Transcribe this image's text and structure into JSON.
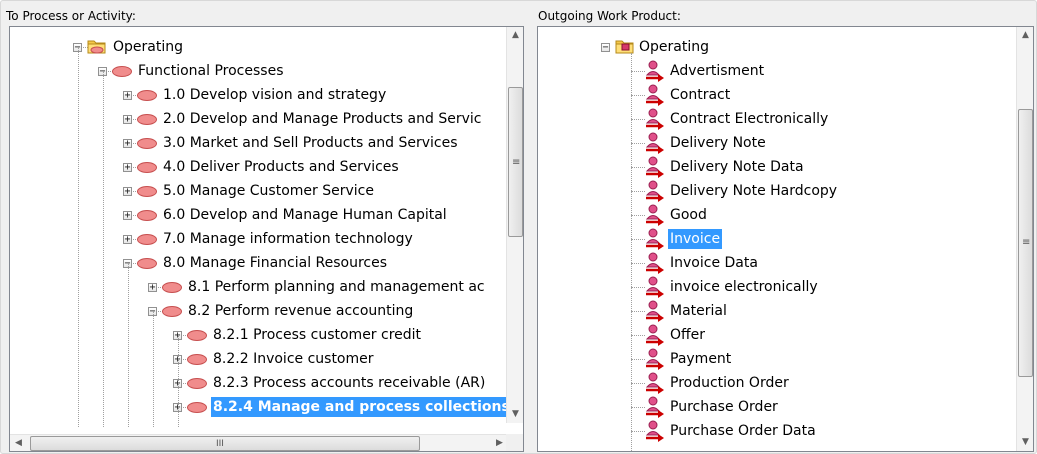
{
  "left_panel": {
    "caption": "To Process or Activity:",
    "items": [
      {
        "label": "Operating",
        "icon": "folder-icon"
      },
      {
        "label": "Functional Processes",
        "icon": "process-oval-icon"
      },
      {
        "label": "1.0 Develop vision and strategy",
        "icon": "process-oval-icon"
      },
      {
        "label": "2.0 Develop and Manage Products and Servic",
        "icon": "process-oval-icon"
      },
      {
        "label": "3.0 Market and Sell Products and Services",
        "icon": "process-oval-icon"
      },
      {
        "label": "4.0 Deliver Products and Services",
        "icon": "process-oval-icon"
      },
      {
        "label": "5.0 Manage Customer Service",
        "icon": "process-oval-icon"
      },
      {
        "label": "6.0 Develop and Manage Human Capital",
        "icon": "process-oval-icon"
      },
      {
        "label": "7.0 Manage information technology",
        "icon": "process-oval-icon"
      },
      {
        "label": "8.0 Manage Financial Resources",
        "icon": "process-oval-icon"
      },
      {
        "label": "8.1 Perform planning and management ac",
        "icon": "process-oval-icon"
      },
      {
        "label": "8.2 Perform revenue accounting",
        "icon": "process-oval-icon"
      },
      {
        "label": "8.2.1 Process customer credit",
        "icon": "process-oval-icon"
      },
      {
        "label": "8.2.2 Invoice customer",
        "icon": "process-oval-icon"
      },
      {
        "label": "8.2.3 Process accounts receivable (AR)",
        "icon": "process-oval-icon"
      },
      {
        "label": "8.2.4 Manage and process collections",
        "icon": "process-oval-icon",
        "selected": true
      }
    ],
    "scroll_grip": "≡",
    "hscroll_grip": "III"
  },
  "right_panel": {
    "caption": "Outgoing Work Product:",
    "root": {
      "label": "Operating",
      "icon": "folder-red-icon"
    },
    "items": [
      {
        "label": "Advertisment"
      },
      {
        "label": "Contract"
      },
      {
        "label": "Contract Electronically"
      },
      {
        "label": "Delivery Note"
      },
      {
        "label": "Delivery Note Data"
      },
      {
        "label": "Delivery Note Hardcopy"
      },
      {
        "label": "Good"
      },
      {
        "label": "Invoice",
        "selected": true
      },
      {
        "label": "Invoice Data"
      },
      {
        "label": "invoice electronically"
      },
      {
        "label": "Material"
      },
      {
        "label": "Offer"
      },
      {
        "label": "Payment"
      },
      {
        "label": "Production Order"
      },
      {
        "label": "Purchase Order"
      },
      {
        "label": "Purchase Order Data"
      }
    ],
    "scroll_grip": "≡"
  },
  "colors": {
    "selection": "#3399ff",
    "oval": "#f08c8c",
    "arrow": "#cc0000"
  }
}
